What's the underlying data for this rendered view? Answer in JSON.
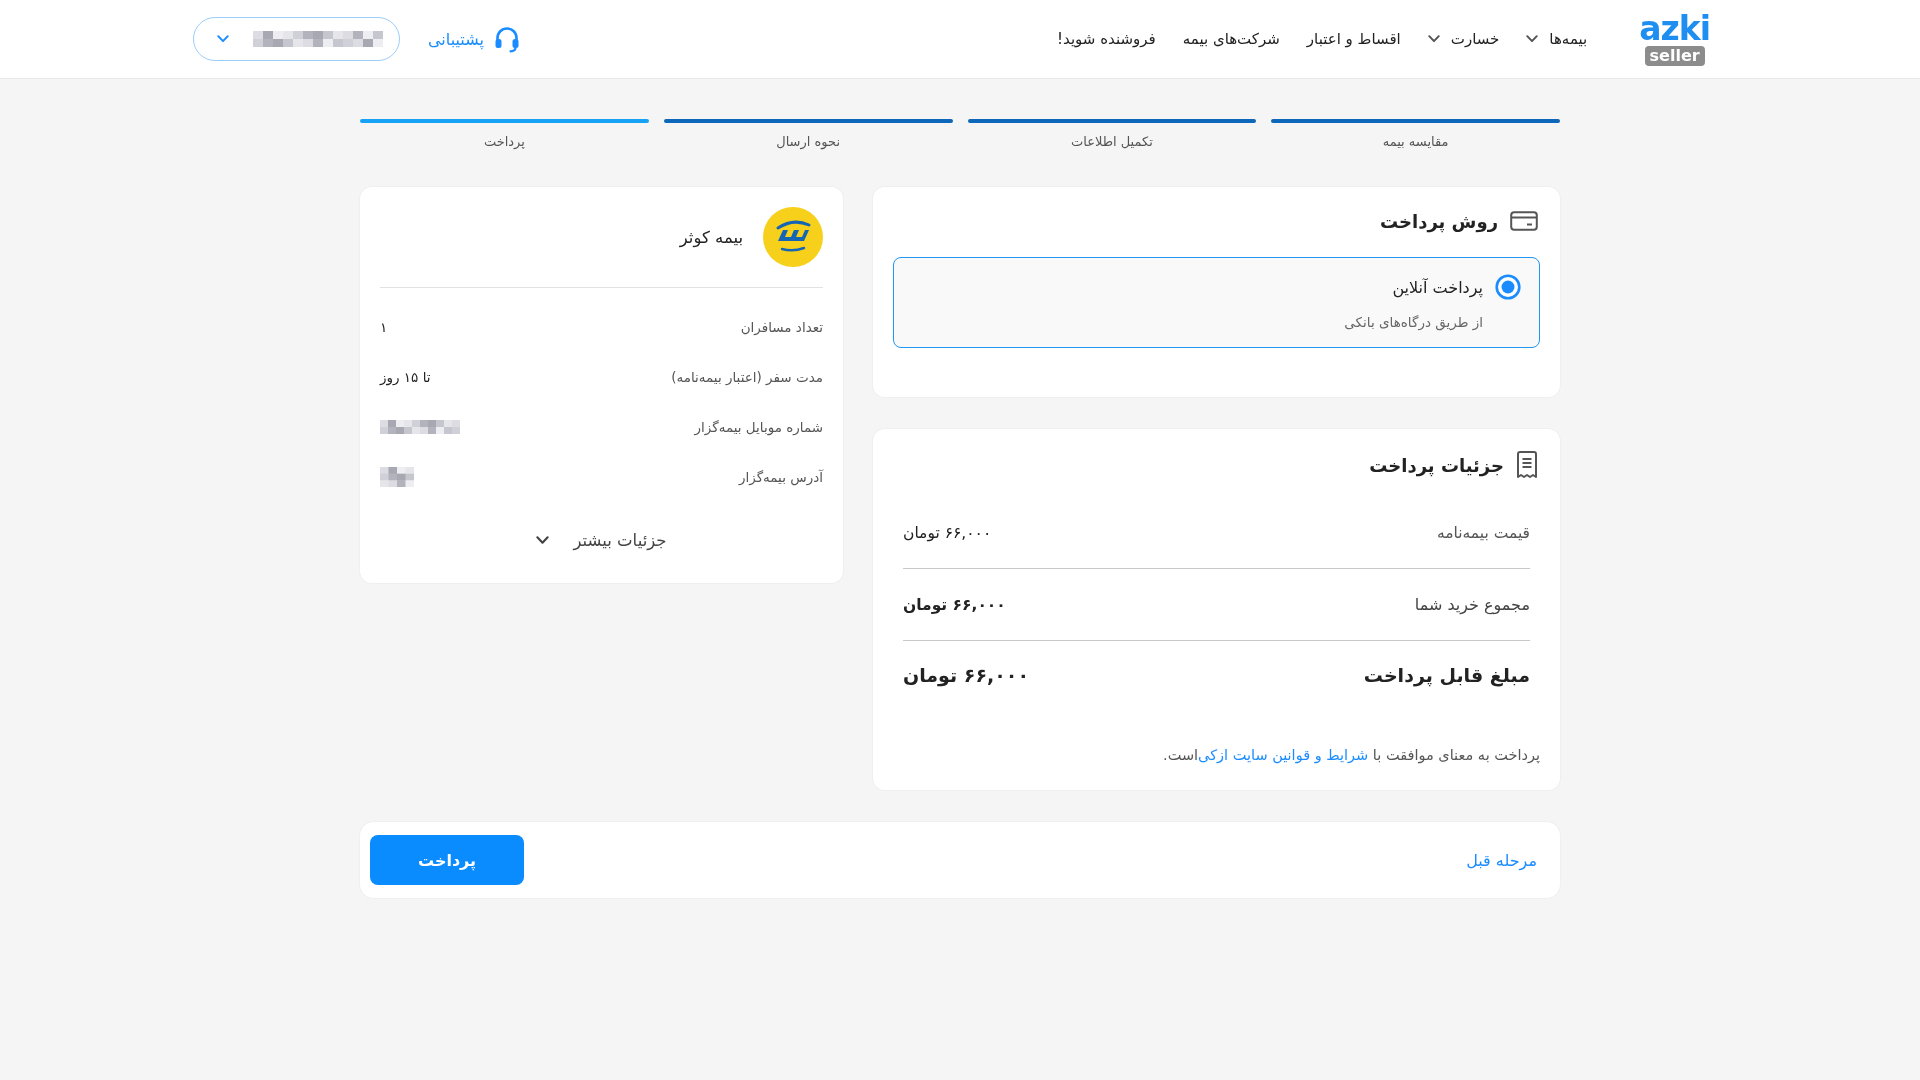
{
  "header": {
    "logo": {
      "wordmark": "azki",
      "subtitle": "seller"
    },
    "nav": [
      {
        "label": "بیمه‌ها",
        "has_menu": true
      },
      {
        "label": "خسارت",
        "has_menu": true
      },
      {
        "label": "اقساط و اعتبار",
        "has_menu": false
      },
      {
        "label": "شرکت‌های بیمه",
        "has_menu": false
      },
      {
        "label": "فروشنده شوید!",
        "has_menu": false
      }
    ],
    "support": {
      "label": "پشتیبانی"
    },
    "account_menu": {
      "kind": "redacted"
    }
  },
  "steps": [
    {
      "label": "مقایسه بیمه",
      "selected": false
    },
    {
      "label": "تکمیل اطلاعات",
      "selected": false
    },
    {
      "label": "نحوه ارسال",
      "selected": false
    },
    {
      "label": "پرداخت",
      "selected": true
    }
  ],
  "payment_method": {
    "title": "روش پرداخت",
    "options": [
      {
        "title": "پرداخت آنلاین",
        "description": "از طریق درگاه‌های بانکی",
        "selected": true
      }
    ]
  },
  "payment_details": {
    "title": "جزئیات پرداخت",
    "rows": [
      {
        "kind": "normal",
        "label": "قیمت بیمه‌نامه",
        "value": "۶۶,۰۰۰ تومان"
      },
      {
        "kind": "subtotal",
        "label": "مجموع خرید شما",
        "value": "۶۶,۰۰۰ تومان"
      },
      {
        "kind": "total",
        "label": "مبلغ قابل پرداخت",
        "value": "۶۶,۰۰۰ تومان"
      }
    ],
    "terms": {
      "before": "پرداخت به معنای موافقت با ",
      "link": "شرایط و قوانین سایت ازکی",
      "after": "است."
    }
  },
  "policy_summary": {
    "insurer": "بیمه کوثر",
    "rows": [
      {
        "kind": "text",
        "label": "تعداد مسافران",
        "value": "۱"
      },
      {
        "kind": "text",
        "label": "مدت سفر (اعتبار بیمه‌نامه)",
        "value": "تا ۱۵ روز"
      },
      {
        "kind": "redacted",
        "label": "شماره موبایل بیمه‌گزار"
      },
      {
        "kind": "redacted",
        "label": "آدرس بیمه‌گزار"
      }
    ],
    "more": {
      "label": "جزئیات بیشتر",
      "expanded": false
    }
  },
  "footer": {
    "back": "مرحله قبل",
    "submit": "پرداخت"
  }
}
